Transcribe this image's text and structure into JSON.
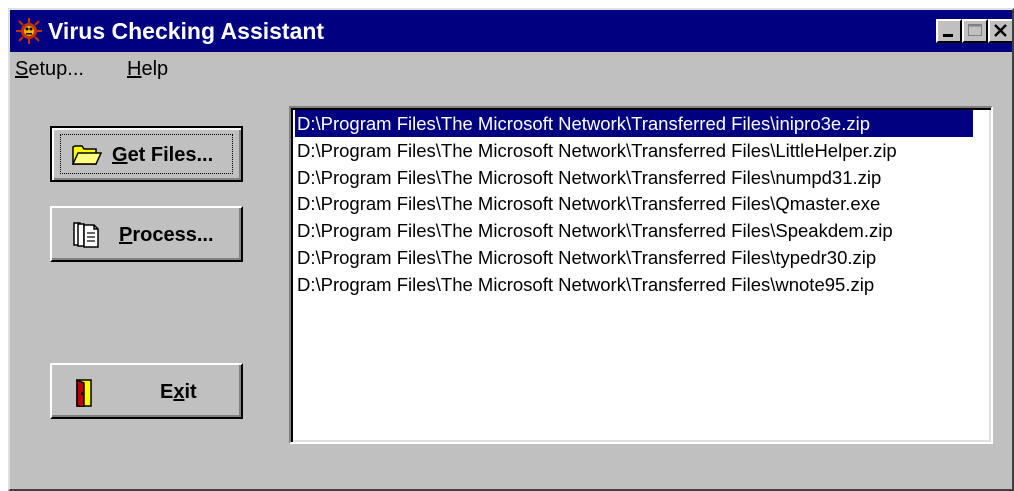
{
  "window": {
    "title": "Virus Checking Assistant",
    "titlebar_color": "#000080",
    "face_color": "#c0c0c0"
  },
  "titlebar_buttons": {
    "minimize": "minimize-icon",
    "maximize": "maximize-icon",
    "close": "close-icon"
  },
  "menu": {
    "setup": {
      "accel": "S",
      "rest": "etup..."
    },
    "help": {
      "accel": "H",
      "rest": "elp"
    }
  },
  "buttons": {
    "get_files": {
      "icon": "open-folder-icon",
      "accel": "G",
      "rest": "et Files..."
    },
    "process": {
      "icon": "process-documents-icon",
      "accel": "P",
      "rest": "rocess..."
    },
    "exit": {
      "icon": "exit-door-icon",
      "pre": "E",
      "accel": "x",
      "rest": "it"
    }
  },
  "file_list": {
    "selected_index": 0,
    "selected_color": "#000080",
    "items": [
      "D:\\Program Files\\The Microsoft Network\\Transferred Files\\inipro3e.zip",
      "D:\\Program Files\\The Microsoft Network\\Transferred Files\\LittleHelper.zip",
      "D:\\Program Files\\The Microsoft Network\\Transferred Files\\numpd31.zip",
      "D:\\Program Files\\The Microsoft Network\\Transferred Files\\Qmaster.exe",
      "D:\\Program Files\\The Microsoft Network\\Transferred Files\\Speakdem.zip",
      "D:\\Program Files\\The Microsoft Network\\Transferred Files\\typedr30.zip",
      "D:\\Program Files\\The Microsoft Network\\Transferred Files\\wnote95.zip"
    ]
  }
}
